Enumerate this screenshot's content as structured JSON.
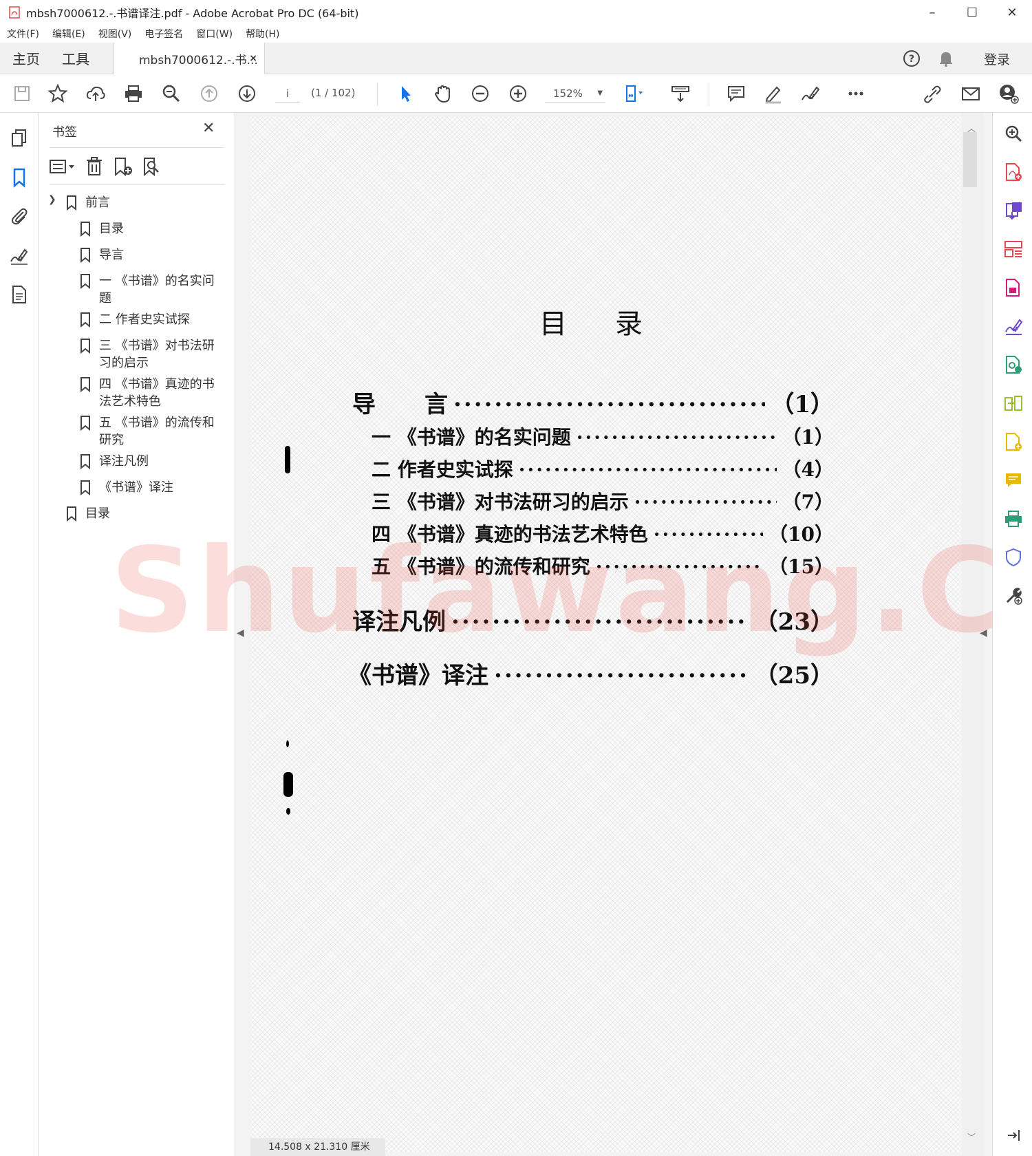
{
  "window": {
    "title": "mbsh7000612.-.书谱译注.pdf - Adobe Acrobat Pro DC (64-bit)",
    "minimize": "–",
    "maximize": "☐",
    "close": "✕"
  },
  "menu": [
    "文件(F)",
    "编辑(E)",
    "视图(V)",
    "电子签名",
    "窗口(W)",
    "帮助(H)"
  ],
  "tabs": {
    "home": "主页",
    "tools": "工具",
    "document": "mbsh7000612.-.书...",
    "close": "×",
    "login": "登录"
  },
  "toolbar": {
    "page_current": "i",
    "page_count": "(1 / 102)",
    "zoom": "152%"
  },
  "bookmarks": {
    "header": "书签",
    "close": "✕",
    "items": [
      {
        "label": "前言",
        "level": 0
      },
      {
        "label": "目录",
        "level": 1
      },
      {
        "label": "导言",
        "level": 1
      },
      {
        "label": "一 《书谱》的名实问题",
        "level": 1
      },
      {
        "label": "二 作者史实试探",
        "level": 1
      },
      {
        "label": "三 《书谱》对书法研习的启示",
        "level": 1
      },
      {
        "label": "四 《书谱》真迹的书法艺术特色",
        "level": 1
      },
      {
        "label": "五 《书谱》的流传和研究",
        "level": 1
      },
      {
        "label": "译注凡例",
        "level": 1
      },
      {
        "label": "《书谱》译注",
        "level": 1
      },
      {
        "label": "目录",
        "level": 0
      }
    ]
  },
  "document": {
    "title": "目录",
    "toc": [
      {
        "label": "导      言",
        "page": "（1）",
        "style": "main"
      },
      {
        "label": "一 《书谱》的名实问题",
        "page": "（1）",
        "style": "sub"
      },
      {
        "label": "二 作者史实试探",
        "page": "（4）",
        "style": "sub"
      },
      {
        "label": "三 《书谱》对书法研习的启示",
        "page": "（7）",
        "style": "sub"
      },
      {
        "label": "四 《书谱》真迹的书法艺术特色",
        "page": "（10）",
        "style": "sub"
      },
      {
        "label": "五 《书谱》的流传和研究",
        "page": "（15）",
        "style": "sub"
      },
      {
        "label": "译注凡例",
        "page": "（23）",
        "style": "main"
      },
      {
        "label": "《书谱》译注",
        "page": "（25）",
        "style": "main"
      }
    ],
    "watermark": "Shufawang.CN",
    "page_size": "14.508 x 21.310 厘米"
  },
  "colors": {
    "accent_blue": "#1473e6",
    "icon_gray": "#4b4b4b",
    "pdf_red": "#e34850",
    "purple": "#6e49cb",
    "green": "#2d9d78",
    "yellow": "#e8b800"
  }
}
